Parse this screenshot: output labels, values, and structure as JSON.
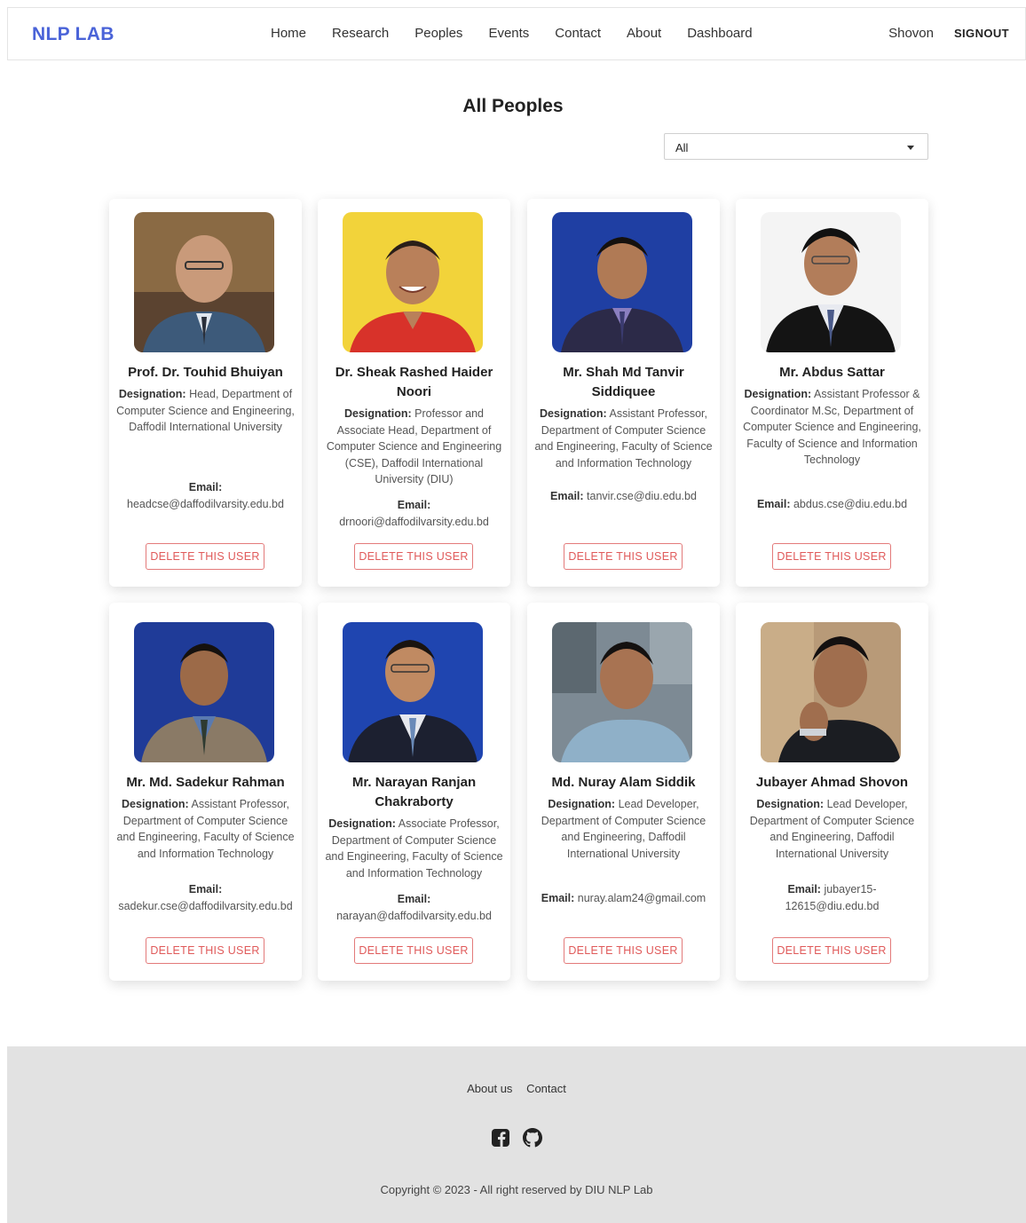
{
  "brand": "NLP LAB",
  "nav": {
    "links": [
      "Home",
      "Research",
      "Peoples",
      "Events",
      "Contact",
      "About",
      "Dashboard"
    ],
    "user": "Shovon",
    "signout": "SIGNOUT"
  },
  "page": {
    "title": "All Peoples",
    "filter_value": "All"
  },
  "labels": {
    "designation": "Designation:",
    "email": "Email:",
    "delete": "DELETE THIS USER"
  },
  "people": [
    {
      "name": "Prof. Dr. Touhid Bhuiyan",
      "designation": "Head, Department of Computer Science and Engineering, Daffodil International University",
      "email": "headcse@daffodilvarsity.edu.bd"
    },
    {
      "name": "Dr. Sheak Rashed Haider Noori",
      "designation": "Professor and Associate Head, Department of Computer Science and Engineering (CSE), Daffodil International University (DIU)",
      "email": "drnoori@daffodilvarsity.edu.bd"
    },
    {
      "name": "Mr. Shah Md Tanvir Siddiquee",
      "designation": "Assistant Professor, Department of Computer Science and Engineering, Faculty of Science and Information Technology",
      "email": "tanvir.cse@diu.edu.bd"
    },
    {
      "name": "Mr. Abdus Sattar",
      "designation": "Assistant Professor & Coordinator M.Sc, Department of Computer Science and Engineering, Faculty of Science and Information Technology",
      "email": "abdus.cse@diu.edu.bd"
    },
    {
      "name": "Mr. Md. Sadekur Rahman",
      "designation": "Assistant Professor, Department of Computer Science and Engineering, Faculty of Science and Information Technology",
      "email": "sadekur.cse@daffodilvarsity.edu.bd"
    },
    {
      "name": "Mr. Narayan Ranjan Chakraborty",
      "designation": "Associate Professor, Department of Computer Science and Engineering, Faculty of Science and Information Technology",
      "email": "narayan@daffodilvarsity.edu.bd"
    },
    {
      "name": "Md. Nuray Alam Siddik",
      "designation": "Lead Developer, Department of Computer Science and Engineering, Daffodil International University",
      "email": "nuray.alam24@gmail.com"
    },
    {
      "name": "Jubayer Ahmad Shovon",
      "designation": "Lead Developer, Department of Computer Science and Engineering, Daffodil International University",
      "email": "jubayer15-12615@diu.edu.bd"
    }
  ],
  "footer": {
    "links": [
      "About us",
      "Contact"
    ],
    "icons": [
      "facebook-icon",
      "github-icon"
    ],
    "copyright": "Copyright © 2023 - All right reserved by DIU NLP Lab"
  },
  "colors": {
    "brand": "#4a63d8",
    "delete": "#e05a5a",
    "footer_bg": "#e2e2e2"
  }
}
